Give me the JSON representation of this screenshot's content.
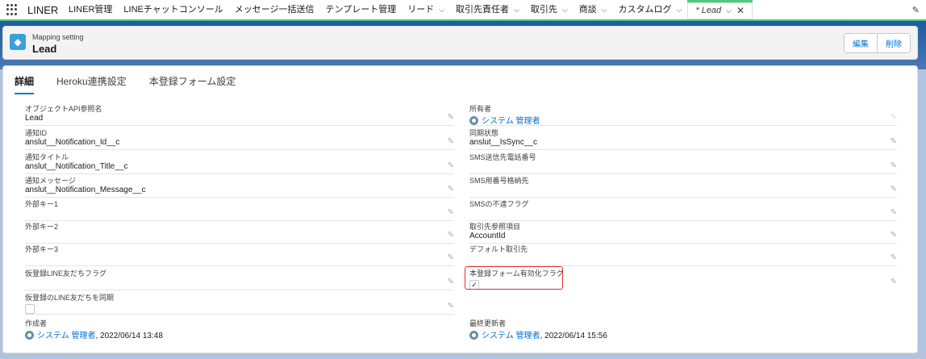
{
  "app": {
    "name": "LINER"
  },
  "nav": {
    "tabs": [
      {
        "label": "LINER管理",
        "chevron": false
      },
      {
        "label": "LINEチャットコンソール",
        "chevron": false
      },
      {
        "label": "メッセージ一括送信",
        "chevron": false
      },
      {
        "label": "テンプレート管理",
        "chevron": false
      },
      {
        "label": "リード",
        "chevron": true
      },
      {
        "label": "取引先責任者",
        "chevron": true
      },
      {
        "label": "取引先",
        "chevron": true
      },
      {
        "label": "商談",
        "chevron": true
      },
      {
        "label": "カスタムログ",
        "chevron": true
      }
    ],
    "active_tab": "* Lead"
  },
  "header": {
    "subtitle": "Mapping setting",
    "title": "Lead",
    "edit_label": "編集",
    "delete_label": "削除"
  },
  "detail_tabs": [
    "詳細",
    "Heroku連携設定",
    "本登録フォーム設定"
  ],
  "fields": {
    "object_api": {
      "label": "オブジェクトAPI参照名",
      "value": "Lead"
    },
    "owner": {
      "label": "所有者",
      "value": "システム 管理者"
    },
    "notification_id": {
      "label": "通知ID",
      "value": "anslut__Notification_Id__c"
    },
    "sync_status": {
      "label": "同期状態",
      "value": "anslut__IsSync__c"
    },
    "notification_title": {
      "label": "通知タイトル",
      "value": "anslut__Notification_Title__c"
    },
    "sms_phone": {
      "label": "SMS送信先電話番号",
      "value": ""
    },
    "notification_message": {
      "label": "通知メッセージ",
      "value": "anslut__Notification_Message__c"
    },
    "sms_store": {
      "label": "SMS用番号格納先",
      "value": ""
    },
    "ext_key1": {
      "label": "外部キー1",
      "value": ""
    },
    "sms_unreachable": {
      "label": "SMSの不達フラグ",
      "value": ""
    },
    "ext_key2": {
      "label": "外部キー2",
      "value": ""
    },
    "account_ref": {
      "label": "取引先参照項目",
      "value": "AccountId"
    },
    "ext_key3": {
      "label": "外部キー3",
      "value": ""
    },
    "default_account": {
      "label": "デフォルト取引先",
      "value": ""
    },
    "temp_friend_flag": {
      "label": "仮登録LINE友だちフラグ",
      "value": ""
    },
    "form_enabled": {
      "label": "本登録フォーム有効化フラグ",
      "value": "✓"
    },
    "temp_friend_sync": {
      "label": "仮登録のLINE友だちを同期",
      "value": ""
    },
    "created_by": {
      "label": "作成者",
      "user": "システム 管理者",
      "date": ", 2022/06/14 13:48"
    },
    "modified_by": {
      "label": "最終更新者",
      "user": "システム 管理者",
      "date": ", 2022/06/14 15:56"
    }
  }
}
